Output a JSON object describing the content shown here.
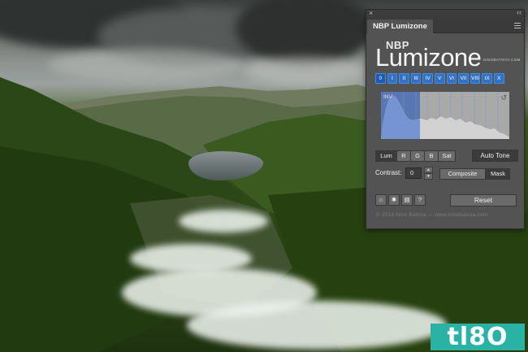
{
  "panel": {
    "close_glyph": "×",
    "collapse_glyph": "‹‹",
    "tab_label": "NBP Lumizone",
    "logo": {
      "prefix": "NBP",
      "name": "Lumizone",
      "site": "NINOBATISTA.COM"
    },
    "zones": [
      "0",
      "I",
      "II",
      "III",
      "IV",
      "V",
      "VI",
      "VII",
      "VIII",
      "IX",
      "X"
    ],
    "histogram": {
      "mode_label": "INV",
      "reset_glyph": "↺"
    },
    "channels": [
      "Lum",
      "R",
      "G",
      "B",
      "Sat"
    ],
    "active_channel": "Lum",
    "auto_tone_label": "Auto Tone",
    "contrast": {
      "label": "Contrast:",
      "value": "0"
    },
    "view_modes": [
      "Composite",
      "Mask"
    ],
    "active_view": "Composite",
    "reset_label": "Reset",
    "copyright": "© 2018 Nino Batista — www.ninobatista.com"
  },
  "watermark": {
    "text": "tl8O"
  },
  "colors": {
    "accent": "#2f72c8",
    "panel_bg": "#535353",
    "watermark_bg": "#2ab3a4"
  }
}
